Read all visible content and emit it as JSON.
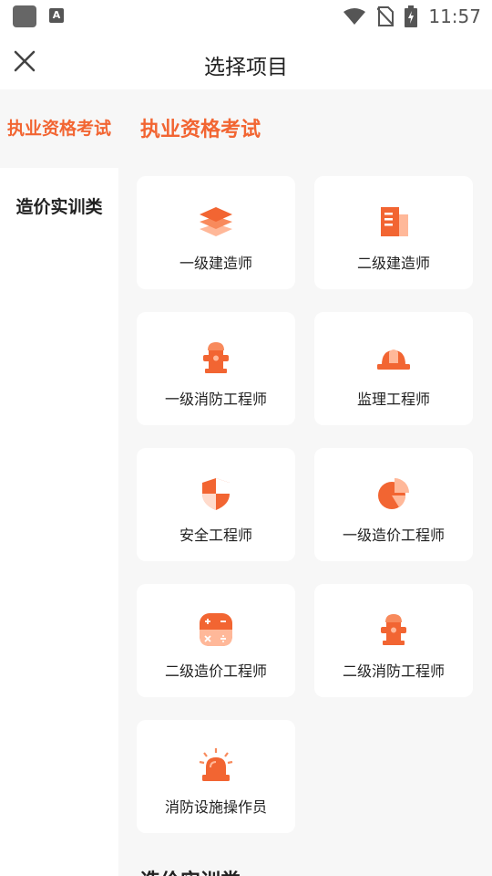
{
  "status_bar": {
    "time": "11:57",
    "notification_badge": "A"
  },
  "header": {
    "title": "选择项目"
  },
  "sidebar": {
    "items": [
      {
        "label": "执业资格考试"
      },
      {
        "label": "造价实训类"
      }
    ]
  },
  "main": {
    "section_title": "执业资格考试",
    "next_section_title": "造价实训类",
    "cards": [
      {
        "label": "一级建造师",
        "icon": "layers-icon"
      },
      {
        "label": "二级建造师",
        "icon": "building-icon"
      },
      {
        "label": "一级消防工程师",
        "icon": "fire-hydrant-icon"
      },
      {
        "label": "监理工程师",
        "icon": "hard-hat-icon"
      },
      {
        "label": "安全工程师",
        "icon": "shield-icon"
      },
      {
        "label": "一级造价工程师",
        "icon": "pie-chart-icon"
      },
      {
        "label": "二级造价工程师",
        "icon": "calculator-icon"
      },
      {
        "label": "二级消防工程师",
        "icon": "fire-hydrant-icon"
      },
      {
        "label": "消防设施操作员",
        "icon": "alarm-light-icon"
      }
    ]
  },
  "colors": {
    "accent": "#f26532",
    "accent_light": "#ffb899",
    "background": "#f7f7f7"
  }
}
